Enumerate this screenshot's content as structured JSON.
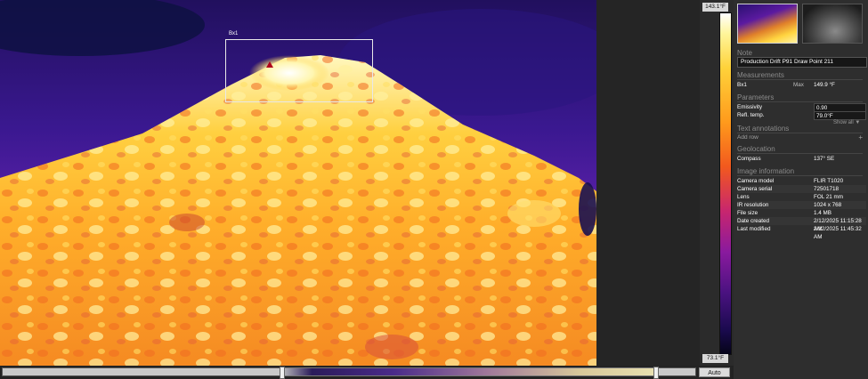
{
  "image": {
    "measurement_label": "Bx1"
  },
  "scale": {
    "max_label": "143.1°F",
    "min_label": "73.1°F"
  },
  "panel": {
    "note": {
      "header": "Note",
      "value": "Production Drift P91 Draw Point 211"
    },
    "measurements": {
      "header": "Measurements",
      "rows": [
        {
          "name": "Bx1",
          "type": "Max",
          "value": "149.9 °F"
        }
      ]
    },
    "parameters": {
      "header": "Parameters",
      "rows": [
        {
          "label": "Emissivity",
          "value": "0.90"
        },
        {
          "label": "Refl. temp.",
          "value": "79.0°F"
        }
      ],
      "show_all": "Show all"
    },
    "text_annotations": {
      "header": "Text annotations",
      "add_row": "Add row",
      "add_icon": "+"
    },
    "geolocation": {
      "header": "Geolocation",
      "rows": [
        {
          "label": "Compass",
          "value": "137° SE"
        }
      ]
    },
    "image_information": {
      "header": "Image information",
      "rows": [
        {
          "label": "Camera model",
          "value": "FLIR T1020"
        },
        {
          "label": "Camera serial",
          "value": "72501718"
        },
        {
          "label": "Lens",
          "value": "FOL 21 mm"
        },
        {
          "label": "IR resolution",
          "value": "1024 x 768"
        },
        {
          "label": "File size",
          "value": "1.4 MB"
        },
        {
          "label": "Date created",
          "value": "2/12/2025 11:15:28 AM"
        },
        {
          "label": "Last modified",
          "value": "2/12/2025 11:45:32 AM"
        }
      ]
    }
  },
  "bottom": {
    "auto_label": "Auto"
  },
  "colors": {
    "background": "#2b2b2b",
    "panel_text": "#d8d8d8",
    "section_header": "#8a8a8a",
    "hot": "#fff59a",
    "cold": "#2a1070"
  }
}
